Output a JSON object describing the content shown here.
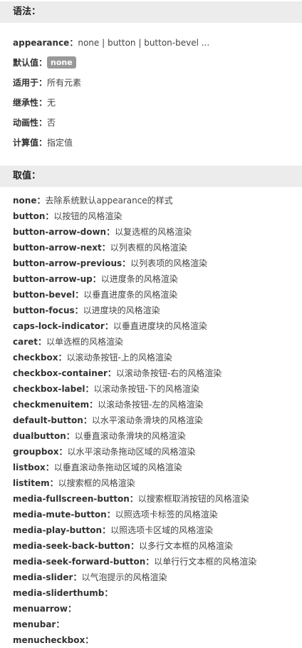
{
  "syntax_section": {
    "title": "语法：",
    "rows": [
      {
        "key": "appearance",
        "sep": "：",
        "value": "none | button | button-bevel ..."
      },
      {
        "key": "默认值",
        "sep": "：",
        "badge": "none"
      },
      {
        "key": "适用于",
        "sep": "：",
        "value": "所有元素"
      },
      {
        "key": "继承性",
        "sep": "：",
        "value": "无"
      },
      {
        "key": "动画性",
        "sep": "：",
        "value": "否"
      },
      {
        "key": "计算值",
        "sep": "：",
        "value": "指定值"
      }
    ]
  },
  "values_section": {
    "title": "取值：",
    "items": [
      {
        "key": "none",
        "sep": "：",
        "desc": "去除系统默认appearance的样式"
      },
      {
        "key": "button",
        "sep": "：",
        "desc": "以按钮的风格渲染"
      },
      {
        "key": "button-arrow-down",
        "sep": "：",
        "desc": "以复选框的风格渲染"
      },
      {
        "key": "button-arrow-next",
        "sep": "：",
        "desc": "以列表框的风格渲染"
      },
      {
        "key": "button-arrow-previous",
        "sep": "：",
        "desc": "以列表项的风格渲染"
      },
      {
        "key": "button-arrow-up",
        "sep": "：",
        "desc": "以进度条的风格渲染"
      },
      {
        "key": "button-bevel",
        "sep": "：",
        "desc": "以垂直进度条的风格渲染"
      },
      {
        "key": "button-focus",
        "sep": "：",
        "desc": "以进度块的风格渲染"
      },
      {
        "key": "caps-lock-indicator",
        "sep": "：",
        "desc": "以垂直进度块的风格渲染"
      },
      {
        "key": "caret",
        "sep": "：",
        "desc": "以单选框的风格渲染"
      },
      {
        "key": "checkbox",
        "sep": "：",
        "desc": "以滚动条按钮-上的风格渲染"
      },
      {
        "key": "checkbox-container",
        "sep": "：",
        "desc": "以滚动条按钮-右的风格渲染"
      },
      {
        "key": "checkbox-label",
        "sep": "：",
        "desc": "以滚动条按钮-下的风格渲染"
      },
      {
        "key": "checkmenuitem",
        "sep": "：",
        "desc": "以滚动条按钮-左的风格渲染"
      },
      {
        "key": "default-button",
        "sep": "：",
        "desc": "以水平滚动条滑块的风格渲染"
      },
      {
        "key": "dualbutton",
        "sep": "：",
        "desc": "以垂直滚动条滑块的风格渲染"
      },
      {
        "key": "groupbox",
        "sep": "：",
        "desc": "以水平滚动条拖动区域的风格渲染"
      },
      {
        "key": "listbox",
        "sep": "：",
        "desc": "以垂直滚动条拖动区域的风格渲染"
      },
      {
        "key": "listitem",
        "sep": "：",
        "desc": "以搜索框的风格渲染"
      },
      {
        "key": "media-fullscreen-button",
        "sep": "：",
        "desc": "以搜索框取消按钮的风格渲染"
      },
      {
        "key": "media-mute-button",
        "sep": "：",
        "desc": "以照选项卡标签的风格渲染"
      },
      {
        "key": "media-play-button",
        "sep": "：",
        "desc": "以照选项卡区域的风格渲染"
      },
      {
        "key": "media-seek-back-button",
        "sep": "：",
        "desc": "以多行文本框的风格渲染"
      },
      {
        "key": "media-seek-forward-button",
        "sep": "：",
        "desc": "以单行行文本框的风格渲染"
      },
      {
        "key": "media-slider",
        "sep": "：",
        "desc": "以气泡提示的风格渲染"
      },
      {
        "key": "media-sliderthumb",
        "sep": "：",
        "desc": ""
      },
      {
        "key": "menuarrow",
        "sep": "：",
        "desc": ""
      },
      {
        "key": "menubar",
        "sep": "：",
        "desc": ""
      },
      {
        "key": "menucheckbox",
        "sep": "：",
        "desc": ""
      }
    ]
  }
}
